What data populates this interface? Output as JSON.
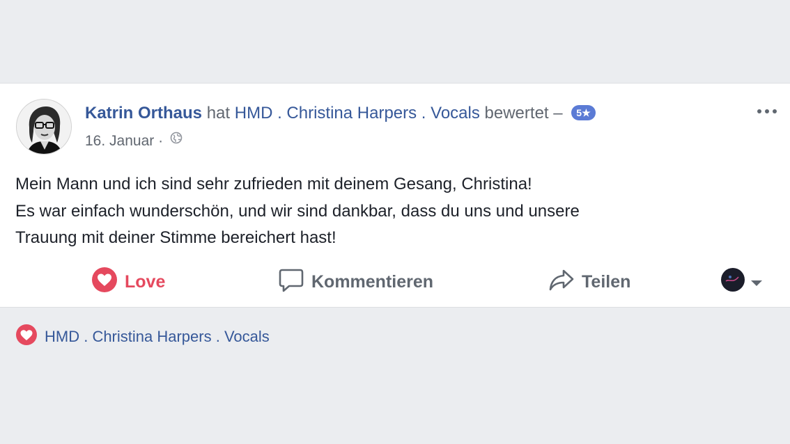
{
  "post": {
    "author": "Katrin Orthaus",
    "verb": "hat",
    "page": "HMD . Christina Harpers . Vocals",
    "action": "bewertet –",
    "rating": "5★",
    "date": "16. Januar",
    "separator": "·",
    "audience_icon": "globe-icon",
    "more_icon": "more-dots-icon",
    "text_lines": [
      "Mein Mann und ich sind sehr zufrieden mit deinem Gesang, Christina!",
      "Es war einfach wunderschön, und wir sind dankbar, dass du uns und unsere",
      "Trauung mit deiner Stimme bereichert hast!"
    ]
  },
  "actions": {
    "love_label": "Love",
    "comment_label": "Kommentieren",
    "share_label": "Teilen"
  },
  "reactions": {
    "liker": "HMD . Christina Harpers . Vocals",
    "icon": "heart-icon"
  },
  "colors": {
    "link": "#365899",
    "love": "#e5495e",
    "badge": "#5b7bd5",
    "background": "#ebedf0"
  }
}
